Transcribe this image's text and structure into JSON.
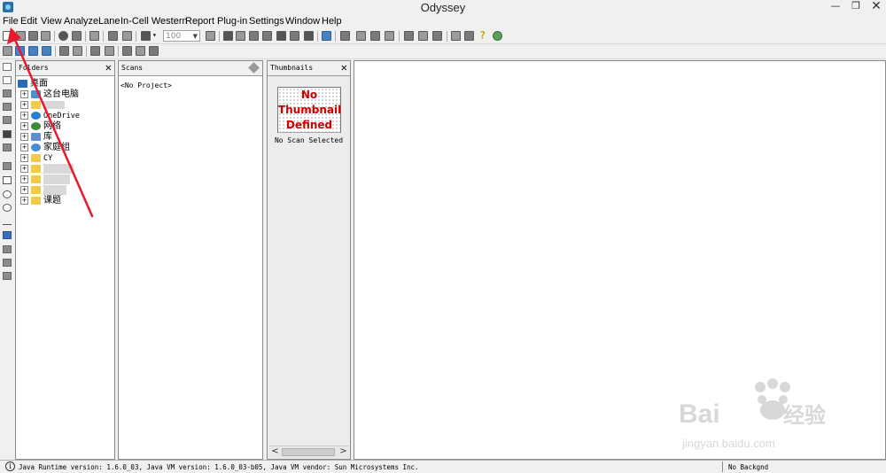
{
  "window": {
    "title": "Odyssey",
    "minimize": "—",
    "restore": "❐",
    "close": "✕"
  },
  "menu": [
    "File",
    "Edit",
    "View",
    "Analyze",
    "Lane",
    "In-Cell Western",
    "Report",
    "Plug-in",
    "Settings",
    "Window",
    "Help"
  ],
  "toolbar": {
    "zoom_value": "100",
    "help_glyph": "?"
  },
  "folders_panel": {
    "title": "Folders",
    "close": "✕",
    "items": [
      {
        "label": "桌面",
        "icon": "desktop-icon",
        "expand": ""
      },
      {
        "label": "这台电脑",
        "icon": "computer-icon",
        "expand": "+"
      },
      {
        "label": "",
        "icon": "folder-icon",
        "expand": "+"
      },
      {
        "label": "OneDrive",
        "icon": "onedrive-icon",
        "expand": "+"
      },
      {
        "label": "网络",
        "icon": "network-icon",
        "expand": "+"
      },
      {
        "label": "库",
        "icon": "library-icon",
        "expand": "+"
      },
      {
        "label": "家庭组",
        "icon": "homegroup-icon",
        "expand": "+"
      },
      {
        "label": "CY",
        "icon": "folder-icon",
        "expand": "+"
      },
      {
        "label": "",
        "icon": "folder-icon",
        "expand": "+"
      },
      {
        "label": "",
        "icon": "folder-icon",
        "expand": "+"
      },
      {
        "label": "",
        "icon": "folder-icon",
        "expand": "+"
      },
      {
        "label": "课题",
        "icon": "folder-icon",
        "expand": "+"
      }
    ]
  },
  "scans_panel": {
    "title": "Scans",
    "content": "<No Project>"
  },
  "thumbnails_panel": {
    "title": "Thumbnails",
    "close": "✕",
    "placeholder_lines": [
      "No",
      "Thumbnail",
      "Defined"
    ],
    "status": "No Scan Selected",
    "scroll_left": "<",
    "scroll_right": ">"
  },
  "statusbar": {
    "info_glyph": "i",
    "message": "Java Runtime version: 1.6.0_03, Java VM version: 1.6.0_03-b05, Java VM vendor: Sun Microsystems Inc.",
    "right": "No Backgnd"
  },
  "watermark": {
    "brand": "Bai",
    "brand_cn": "经验",
    "url": "jingyan.baidu.com"
  },
  "colors": {
    "annotation_arrow": "#e8192c",
    "thumbnail_text": "#d00000"
  }
}
